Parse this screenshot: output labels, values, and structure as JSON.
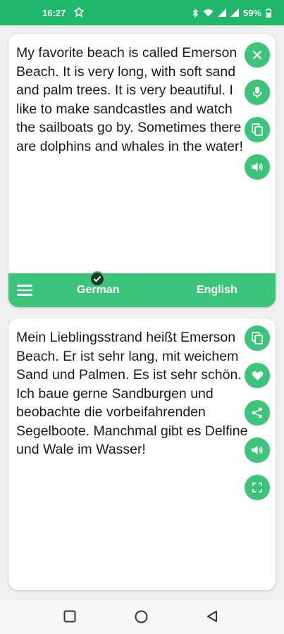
{
  "status": {
    "time": "16:27",
    "battery": "59%"
  },
  "source": {
    "text": "My favorite beach is called Emerson Beach. It is very long, with soft sand and palm trees. It is very beautiful. I like to make sandcastles and watch the sailboats go by. Sometimes there are dolphins and whales in the water!"
  },
  "language_bar": {
    "source_language": "German",
    "target_language": "English"
  },
  "target": {
    "text": "Mein Lieblingsstrand heißt Emerson Beach. Er ist sehr lang, mit weichem Sand und Palmen. Es ist sehr schön. Ich baue gerne Sandburgen und beobachte die vorbeifahrenden Segelboote. Manchmal gibt es Delfine und Wale im Wasser!"
  },
  "colors": {
    "status_bar": "#1fb76b",
    "accent": "#3cc47a",
    "card": "#ffffff",
    "background": "#efefef"
  },
  "icons": {
    "source_actions": [
      "close-icon",
      "mic-icon",
      "copy-icon",
      "speaker-icon"
    ],
    "target_actions": [
      "copy-icon",
      "heart-icon",
      "share-icon",
      "speaker-icon",
      "fullscreen-icon"
    ],
    "nav": [
      "square-icon",
      "circle-icon",
      "back-triangle-icon"
    ]
  }
}
